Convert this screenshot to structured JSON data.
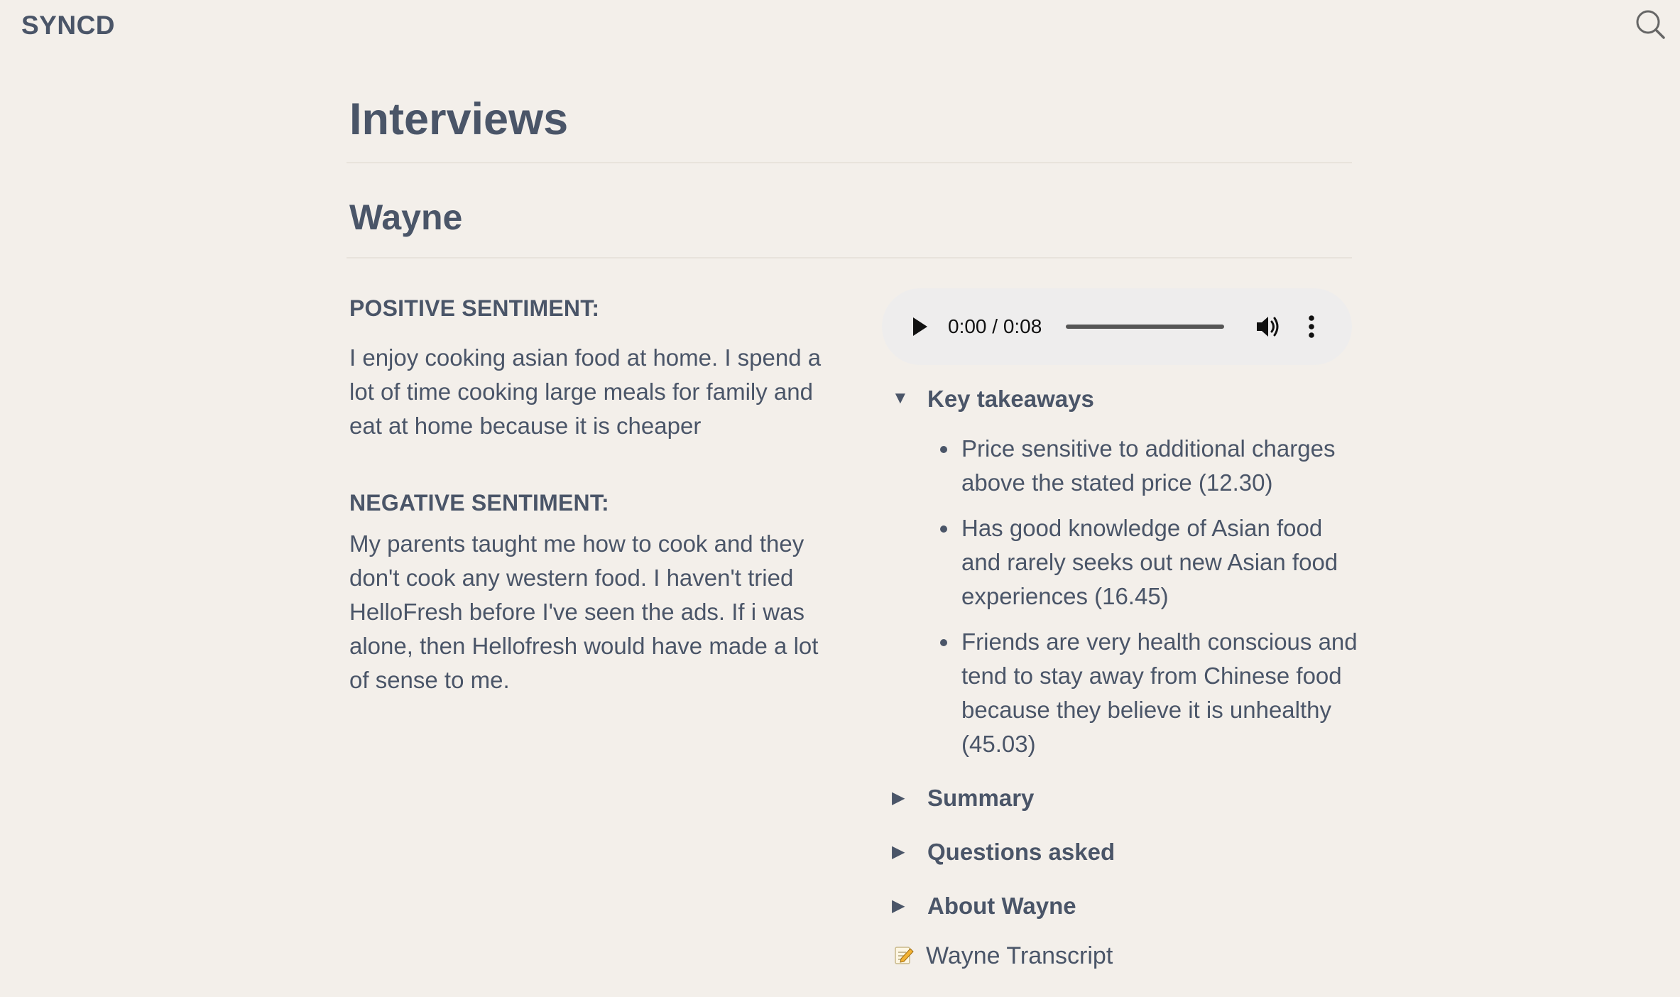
{
  "app": {
    "logo": "SYNCD",
    "search_icon": "search-icon"
  },
  "page": {
    "title": "Interviews"
  },
  "interview": {
    "name": "Wayne",
    "positive_label": "POSITIVE SENTIMENT:",
    "positive_text": "I enjoy cooking asian food at home. I spend a lot of time cooking large meals for family and eat at home because it is cheaper",
    "negative_label": "NEGATIVE SENTIMENT:",
    "negative_text": "My parents taught me how to cook and they don't cook any western food. I haven't tried HelloFresh before I've seen the ads. If i was alone, then Hellofresh would have made a lot of sense to me."
  },
  "audio": {
    "time": "0:00 / 0:08",
    "progress": 0
  },
  "key_takeaways": {
    "label": "Key takeaways",
    "expanded": true,
    "items": [
      "Price sensitive to additional charges above the stated price (12.30)",
      "Has good knowledge of Asian food and rarely seeks out new Asian food experiences (16.45)",
      "Friends are very health conscious and tend to stay away from Chinese food because they believe it is unhealthy (45.03)"
    ]
  },
  "toggles": [
    {
      "label": "Summary",
      "expanded": false
    },
    {
      "label": "Questions asked",
      "expanded": false
    },
    {
      "label": "About Wayne",
      "expanded": false
    }
  ],
  "transcript": {
    "label": "Wayne Transcript",
    "icon": "memo-icon"
  },
  "colors": {
    "background": "#f3efea",
    "text": "#4a5568",
    "audio_bg": "#eeeded"
  }
}
